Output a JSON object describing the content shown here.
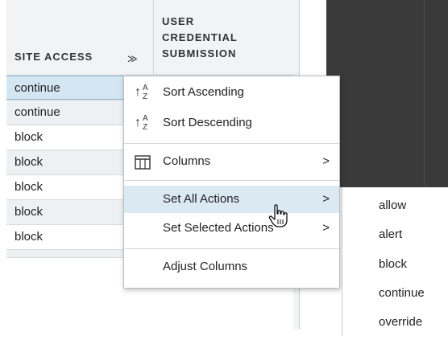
{
  "table": {
    "headers": {
      "site_access": "SITE ACCESS",
      "user_credential_line1": "USER",
      "user_credential_line2": "CREDENTIAL",
      "user_credential_line3": "SUBMISSION"
    },
    "rows": [
      "continue",
      "continue",
      "block",
      "block",
      "block",
      "block",
      "block"
    ]
  },
  "context_menu": {
    "sort_ascending": "Sort Ascending",
    "sort_descending": "Sort Descending",
    "columns": "Columns",
    "set_all_actions": "Set All Actions",
    "set_selected_actions": "Set Selected Actions",
    "adjust_columns": "Adjust Columns",
    "submenu_arrow": ">",
    "sort_arrow": "↑",
    "sort_a": "A",
    "sort_z": "Z",
    "header_chevron": "≫"
  },
  "submenu": {
    "items": [
      "allow",
      "alert",
      "block",
      "continue",
      "override"
    ]
  },
  "colors": {
    "menu_highlight": "#dbe9f3",
    "selected_row": "#d4e6f2",
    "header_bg": "#f2f3f4"
  },
  "icons": [
    "sort-ascending-icon",
    "sort-descending-icon",
    "columns-icon",
    "chevron-right-icon",
    "hand-cursor-icon"
  ]
}
